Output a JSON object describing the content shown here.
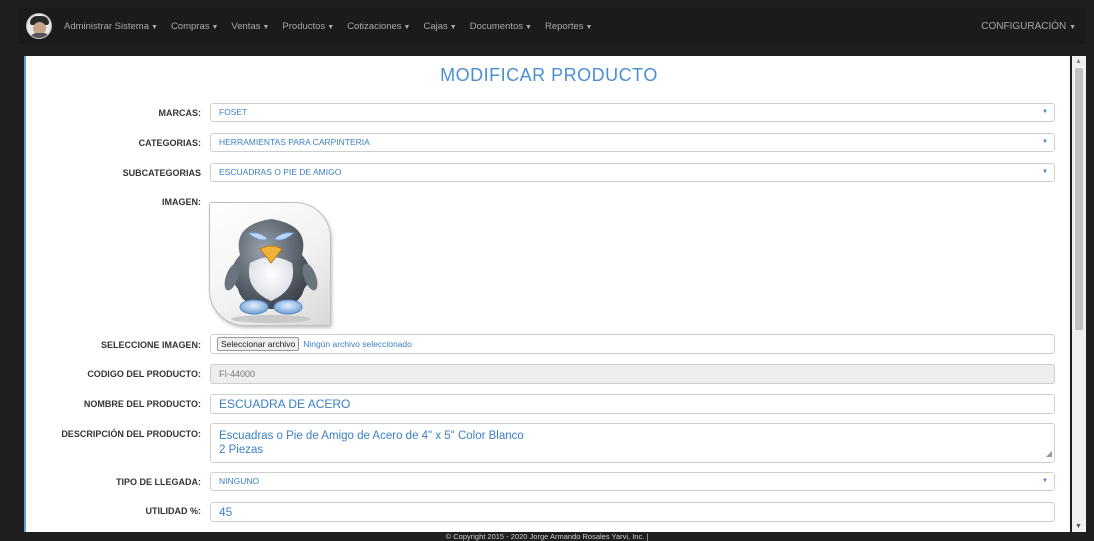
{
  "navbar": {
    "items": [
      {
        "label": "Administrar Sistema"
      },
      {
        "label": "Compras"
      },
      {
        "label": "Ventas"
      },
      {
        "label": "Productos"
      },
      {
        "label": "Cotizaciones"
      },
      {
        "label": "Cajas"
      },
      {
        "label": "Documentos"
      },
      {
        "label": "Reportes"
      }
    ],
    "right_label": "CONFIGURACIÓN"
  },
  "page": {
    "title": "MODIFICAR PRODUCTO"
  },
  "form": {
    "marcas": {
      "label": "MARCAS:",
      "value": "FOSET"
    },
    "categorias": {
      "label": "CATEGORIAS:",
      "value": "HERRAMIENTAS PARA CARPINTERIA"
    },
    "subcategorias": {
      "label": "SUBCATEGORIAS",
      "value": "ESCUADRAS O PIE DE AMIGO"
    },
    "imagen": {
      "label": "IMAGEN:",
      "icon": "penguin-image"
    },
    "seleccione_imagen": {
      "label": "SELECCIONE IMAGEN:",
      "button_label": "Seleccionar archivo",
      "status": "Ningún archivo seleccionado"
    },
    "codigo": {
      "label": "CODIGO DEL PRODUCTO:",
      "value": "FI-44000"
    },
    "nombre": {
      "label": "NOMBRE DEL PRODUCTO:",
      "value": "ESCUADRA DE ACERO"
    },
    "descripcion": {
      "label": "DESCRIPCIÓN DEL PRODUCTO:",
      "line1": "Escuadras o Pie de Amigo de Acero de 4\" x 5\" Color Blanco",
      "line2": "2  Piezas"
    },
    "tipo_llegada": {
      "label": "TIPO DE LLEGADA:",
      "value": "NINGUNO"
    },
    "utilidad": {
      "label": "UTILIDAD %:",
      "value": "45"
    }
  },
  "footer": {
    "text": "© Copyright 2015 - 2020 Jorge Armando Rosales Yarvi, Inc. |"
  },
  "colors": {
    "accent": "#4a8fd4",
    "navbar_bg": "#1b1b1b",
    "field_text": "#3b7fc4"
  }
}
